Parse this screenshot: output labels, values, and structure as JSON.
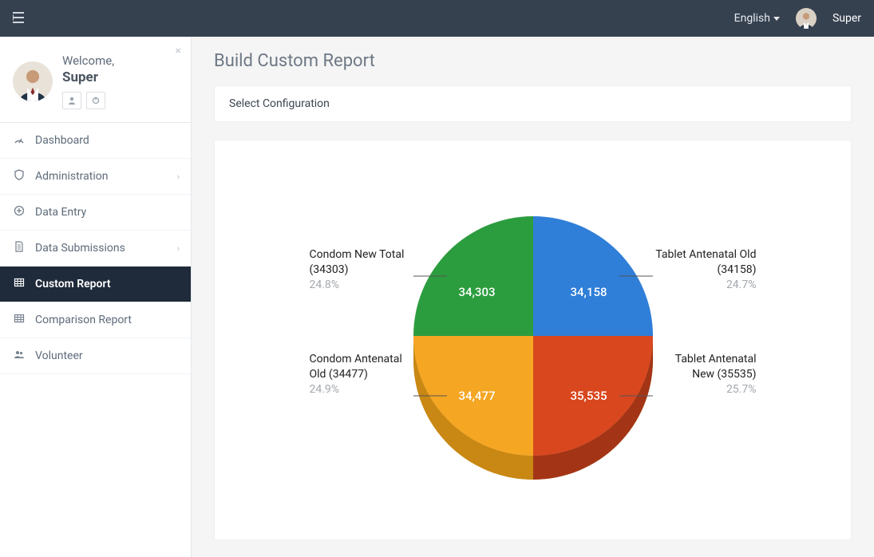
{
  "topbar": {
    "language": "English",
    "user_name": "Super"
  },
  "sidebar": {
    "welcome_label": "Welcome,",
    "user_name": "Super",
    "items": [
      {
        "id": "dashboard",
        "label": "Dashboard",
        "icon": "gauge",
        "chevron": false
      },
      {
        "id": "administration",
        "label": "Administration",
        "icon": "shield",
        "chevron": true
      },
      {
        "id": "data-entry",
        "label": "Data Entry",
        "icon": "plus-circle",
        "chevron": false
      },
      {
        "id": "data-submissions",
        "label": "Data Submissions",
        "icon": "doc",
        "chevron": true
      },
      {
        "id": "custom-report",
        "label": "Custom Report",
        "icon": "grid",
        "chevron": false,
        "active": true
      },
      {
        "id": "comparison-report",
        "label": "Comparison Report",
        "icon": "grid",
        "chevron": false
      },
      {
        "id": "volunteer",
        "label": "Volunteer",
        "icon": "users",
        "chevron": false
      }
    ]
  },
  "page": {
    "title": "Build Custom Report",
    "config_header": "Select Configuration"
  },
  "chart_data": {
    "type": "pie",
    "title": "",
    "series": [
      {
        "name": "Tablet Antenatal Old (34158)",
        "short": "Tablet Antenatal Old",
        "value": 34158,
        "value_display": "34,158",
        "percent": "24.7%",
        "color": "#2f7ed8"
      },
      {
        "name": "Tablet Antenatal New (35535)",
        "short": "Tablet Antenatal New",
        "value": 35535,
        "value_display": "35,535",
        "percent": "25.7%",
        "color": "#d9471f"
      },
      {
        "name": "Condom Antenatal Old (34477)",
        "short": "Condom Antenatal Old",
        "value": 34477,
        "value_display": "34,477",
        "percent": "24.9%",
        "color": "#f5a623"
      },
      {
        "name": "Condom New Total (34303)",
        "short": "Condom New Total",
        "value": 34303,
        "value_display": "34,303",
        "percent": "24.8%",
        "color": "#2c9d3f"
      }
    ]
  }
}
